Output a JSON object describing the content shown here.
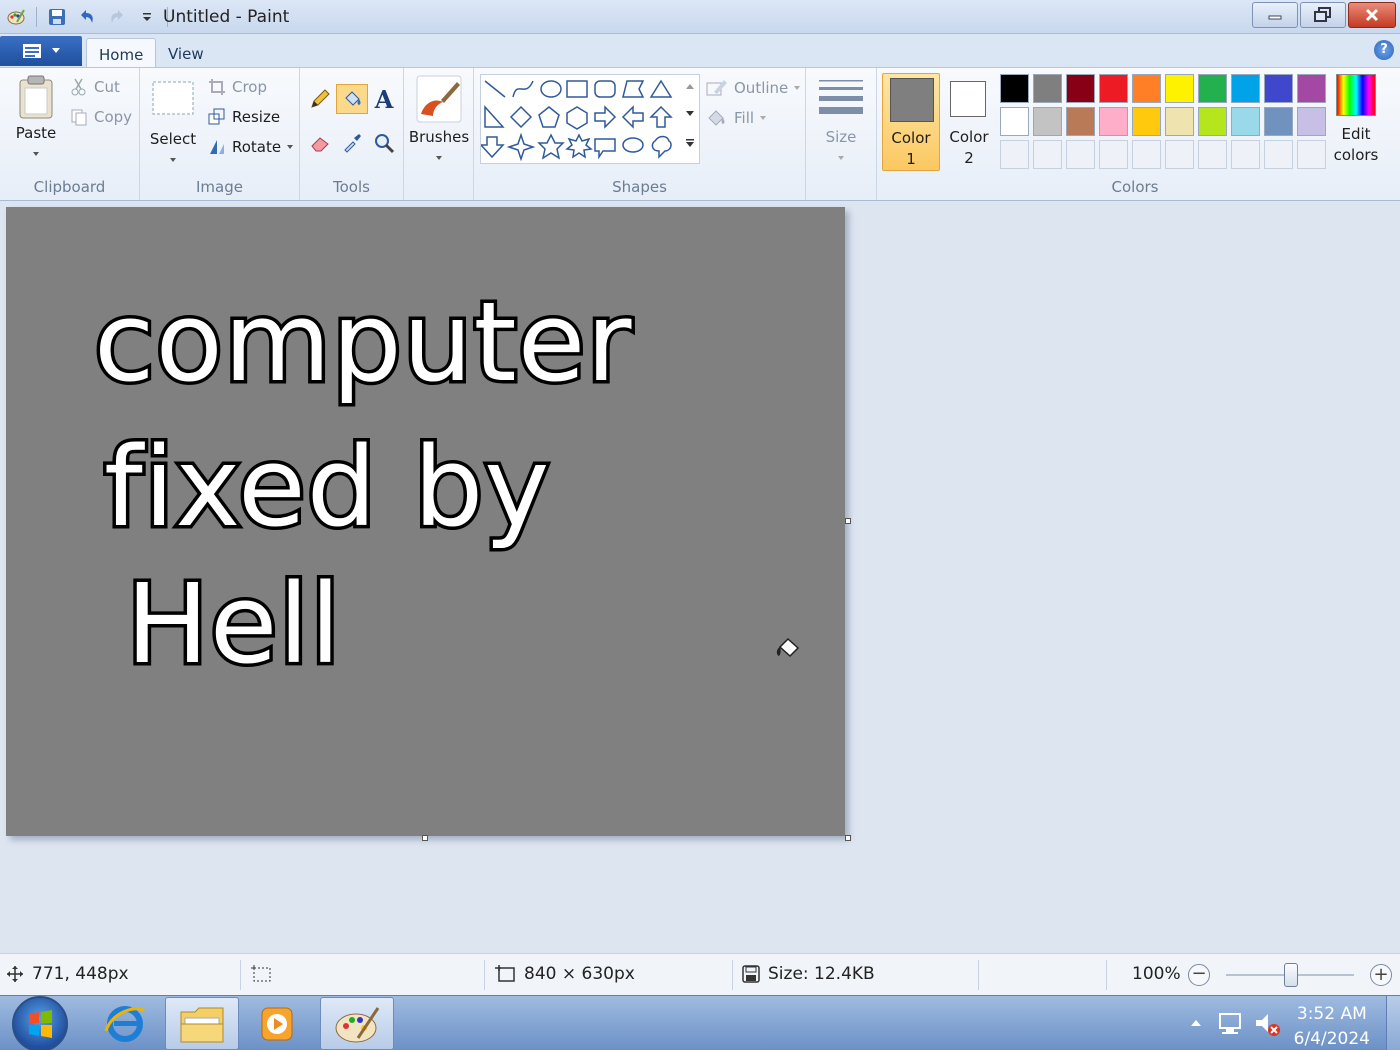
{
  "window": {
    "title": "Untitled - Paint"
  },
  "quick_access": {
    "icons": [
      "paint-app-icon",
      "save-icon",
      "undo-icon",
      "redo-icon",
      "customize-qat-icon"
    ]
  },
  "tabs": [
    {
      "label": "Home",
      "selected": true
    },
    {
      "label": "View",
      "selected": false
    }
  ],
  "ribbon": {
    "clipboard": {
      "label": "Clipboard",
      "paste": "Paste",
      "cut": "Cut",
      "copy": "Copy"
    },
    "image": {
      "label": "Image",
      "select": "Select",
      "crop": "Crop",
      "resize": "Resize",
      "rotate": "Rotate"
    },
    "tools": {
      "label": "Tools"
    },
    "brushes": {
      "label": "Brushes"
    },
    "shapes": {
      "label": "Shapes",
      "outline": "Outline",
      "fill": "Fill"
    },
    "size": {
      "label": "Size"
    },
    "colors": {
      "label": "Colors",
      "color1_label": "Color",
      "color1_num": "1",
      "color2_label": "Color",
      "color2_num": "2",
      "edit_label": "Edit",
      "edit_label2": "colors",
      "color1": "#7f7f7f",
      "color2": "#ffffff",
      "palette_row1": [
        "#000000",
        "#7f7f7f",
        "#880015",
        "#ed1c24",
        "#ff7f27",
        "#fff200",
        "#22b14c",
        "#00a2e8",
        "#3f48cc",
        "#a349a4"
      ],
      "palette_row2": [
        "#ffffff",
        "#c3c3c3",
        "#b97a57",
        "#ffaec9",
        "#ffc90e",
        "#efe4b0",
        "#b5e61d",
        "#99d9ea",
        "#7092be",
        "#c8bfe7"
      ]
    }
  },
  "canvas": {
    "background": "#808080",
    "lines": [
      "computer",
      "fixed by",
      "Hell"
    ]
  },
  "status": {
    "cursor_pos": "771, 448px",
    "selection_size": "",
    "image_size": "840 × 630px",
    "file_size": "Size: 12.4KB",
    "zoom": "100%"
  },
  "taskbar": {
    "time": "3:52 AM",
    "date": "6/4/2024"
  }
}
